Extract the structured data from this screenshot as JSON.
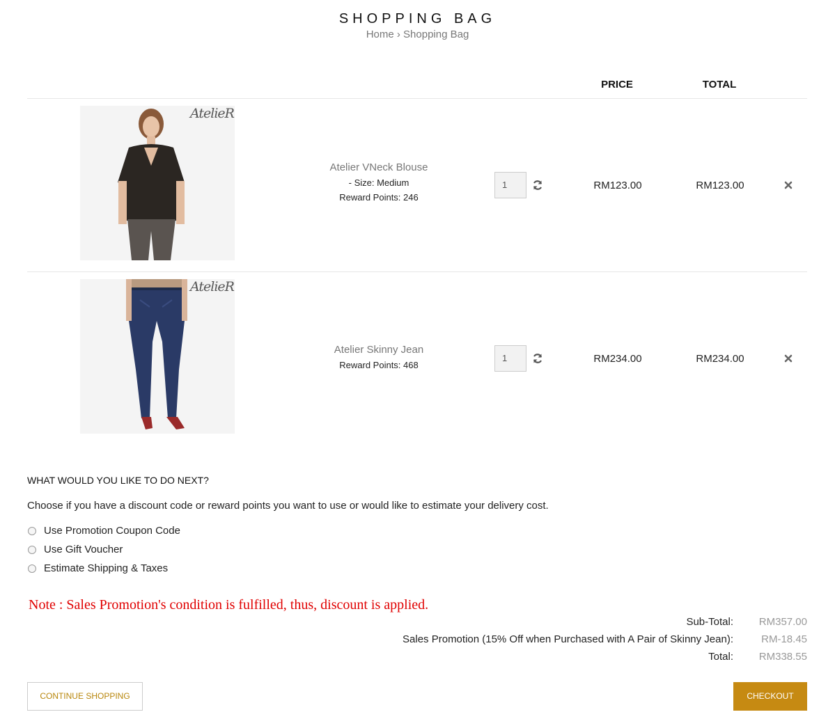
{
  "header": {
    "title": "SHOPPING BAG",
    "breadcrumb_home": "Home",
    "breadcrumb_sep": "›",
    "breadcrumb_current": "Shopping Bag"
  },
  "table": {
    "col_price": "PRICE",
    "col_total": "TOTAL"
  },
  "items": [
    {
      "brand": "AtelieR",
      "name": "Atelier VNeck Blouse",
      "size": "- Size: Medium",
      "reward": "Reward Points: 246",
      "qty": "1",
      "price": "RM123.00",
      "total": "RM123.00"
    },
    {
      "brand": "AtelieR",
      "name": "Atelier Skinny Jean",
      "reward": "Reward Points: 468",
      "qty": "1",
      "price": "RM234.00",
      "total": "RM234.00"
    }
  ],
  "next": {
    "title": "WHAT WOULD YOU LIKE TO DO NEXT?",
    "description": "Choose if you have a discount code or reward points you want to use or would like to estimate your delivery cost.",
    "options": [
      "Use Promotion Coupon Code",
      "Use Gift Voucher",
      "Estimate Shipping & Taxes"
    ]
  },
  "note": "Note : Sales Promotion's condition is fulfilled, thus, discount is applied.",
  "summary": {
    "subtotal_label": "Sub-Total:",
    "subtotal_value": "RM357.00",
    "promo_label": "Sales Promotion (15% Off when Purchased with A Pair of Skinny Jean):",
    "promo_value": "RM-18.45",
    "total_label": "Total:",
    "total_value": "RM338.55"
  },
  "buttons": {
    "continue": "CONTINUE SHOPPING",
    "checkout": "CHECKOUT"
  },
  "colors": {
    "accent": "#c68a12",
    "note": "#e00000"
  }
}
